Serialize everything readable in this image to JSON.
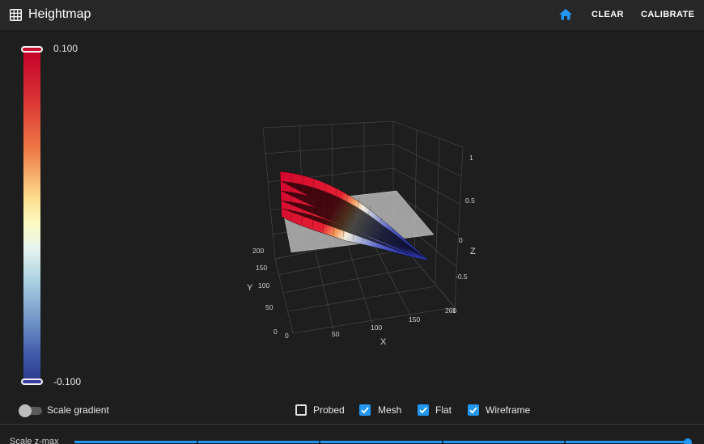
{
  "header": {
    "title": "Heightmap",
    "icon": "grid-icon",
    "home_icon": "home-icon",
    "clear_label": "CLEAR",
    "calibrate_label": "CALIBRATE"
  },
  "gradient": {
    "max_label": "0.100",
    "min_label": "-0.100"
  },
  "plot": {
    "x_axis_label": "X",
    "y_axis_label": "Y",
    "z_axis_label": "Z",
    "x_ticks": [
      "0",
      "50",
      "100",
      "150",
      "200"
    ],
    "y_ticks": [
      "0",
      "50",
      "100",
      "150",
      "200"
    ],
    "z_ticks": [
      "1",
      "0.5",
      "0",
      "-0.5",
      "-1"
    ]
  },
  "controls": {
    "scale_gradient_label": "Scale gradient",
    "scale_gradient_on": false,
    "probed_label": "Probed",
    "probed_checked": false,
    "mesh_label": "Mesh",
    "mesh_checked": true,
    "flat_label": "Flat",
    "flat_checked": true,
    "wireframe_label": "Wireframe",
    "wireframe_checked": true
  },
  "slider": {
    "label": "Scale z-max",
    "value_fraction": 1.0
  },
  "colors": {
    "accent": "#2196f3",
    "background": "#1e1e1e",
    "header": "#272727"
  }
}
